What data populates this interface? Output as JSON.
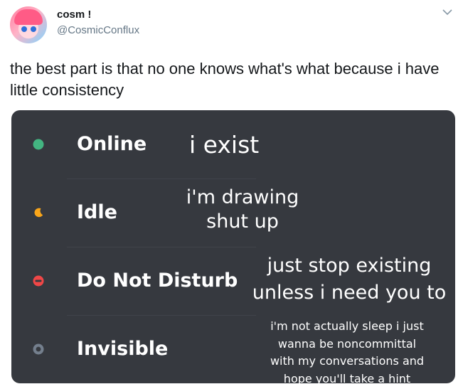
{
  "tweet": {
    "display_name": "cosm !",
    "handle": "@CosmicConflux",
    "text": "the best part is that no one knows what's what because i have little consistency"
  },
  "icons": {
    "avatar": "avatar-illustration",
    "menu": "chevron-down-icon"
  },
  "statuses": [
    {
      "label": "Online",
      "icon": "online-dot-icon",
      "color": "#43b581",
      "note": [
        "i exist"
      ]
    },
    {
      "label": "Idle",
      "icon": "idle-moon-icon",
      "color": "#faa61a",
      "note": [
        "i'm drawing",
        "shut up"
      ]
    },
    {
      "label": "Do Not Disturb",
      "icon": "dnd-icon",
      "color": "#f04747",
      "note": [
        "just stop existing",
        "unless i need you to"
      ]
    },
    {
      "label": "Invisible",
      "icon": "invisible-ring-icon",
      "color": "#747f8d",
      "note": [
        "i'm not actually sleep i just",
        "wanna be noncommittal",
        "with my conversations and",
        "hope you'll take a hint"
      ]
    }
  ]
}
